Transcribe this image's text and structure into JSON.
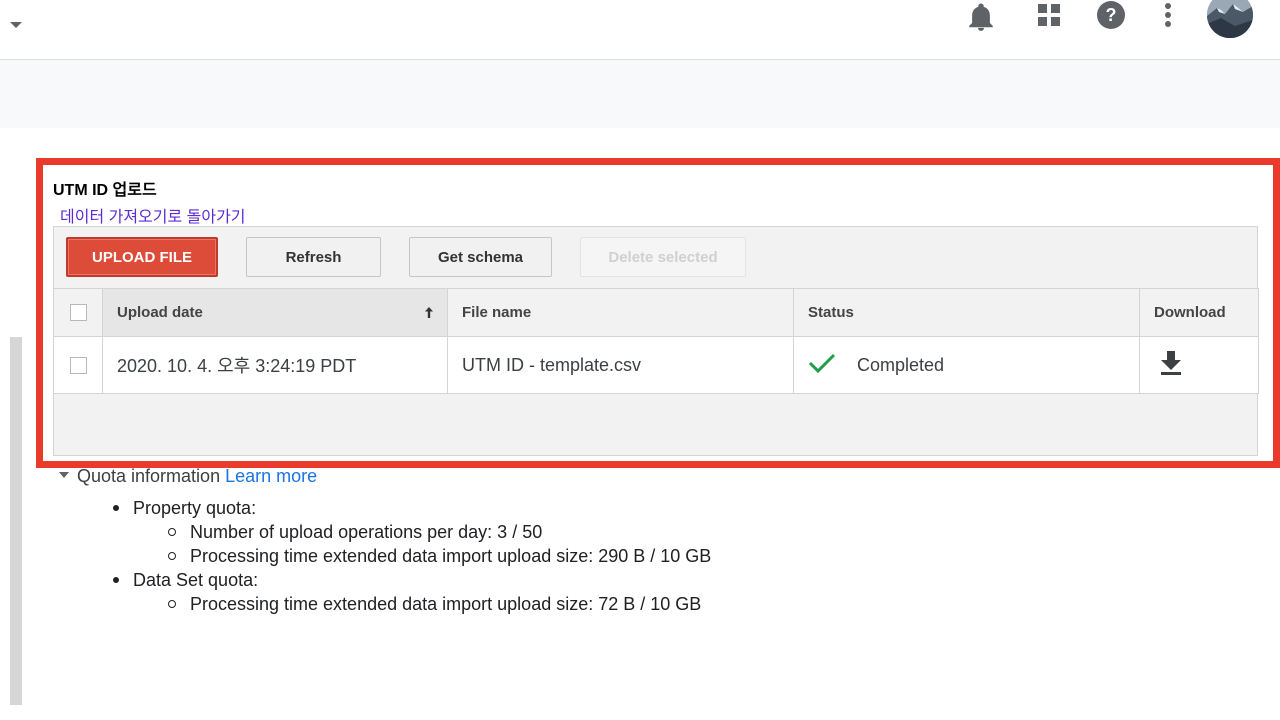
{
  "header": {
    "icons": [
      "notifications-icon",
      "apps-icon",
      "help-icon",
      "more-vert-icon",
      "avatar"
    ]
  },
  "upload": {
    "title": "UTM ID 업로드",
    "back_link": "데이터 가져오기로 돌아가기",
    "buttons": {
      "upload_file": "UPLOAD FILE",
      "refresh": "Refresh",
      "get_schema": "Get schema",
      "delete_selected": "Delete selected"
    },
    "table": {
      "headers": [
        "Upload date",
        "File name",
        "Status",
        "Download"
      ],
      "sort_indicator": "🠕",
      "rows": [
        {
          "upload_date": "2020. 10. 4. 오후 3:24:19 PDT",
          "file_name": "UTM ID - template.csv",
          "status": "Completed"
        }
      ]
    }
  },
  "quota": {
    "label": "Quota information",
    "learn_more": "Learn more",
    "property_quota": "Property quota:",
    "property_items": [
      "Number of upload operations per day: 3 / 50",
      "Processing time extended data import upload size: 290 B / 10 GB"
    ],
    "dataset_quota": "Data Set quota:",
    "dataset_items": [
      "Processing time extended data import upload size: 72 B / 10 GB"
    ]
  },
  "colors": {
    "highlight": "#ea3a2c",
    "upload_button": "#dd4b39",
    "status_ok": "#1e9e4a",
    "link": "#1a73e8",
    "back_link": "#5b2bd4"
  }
}
